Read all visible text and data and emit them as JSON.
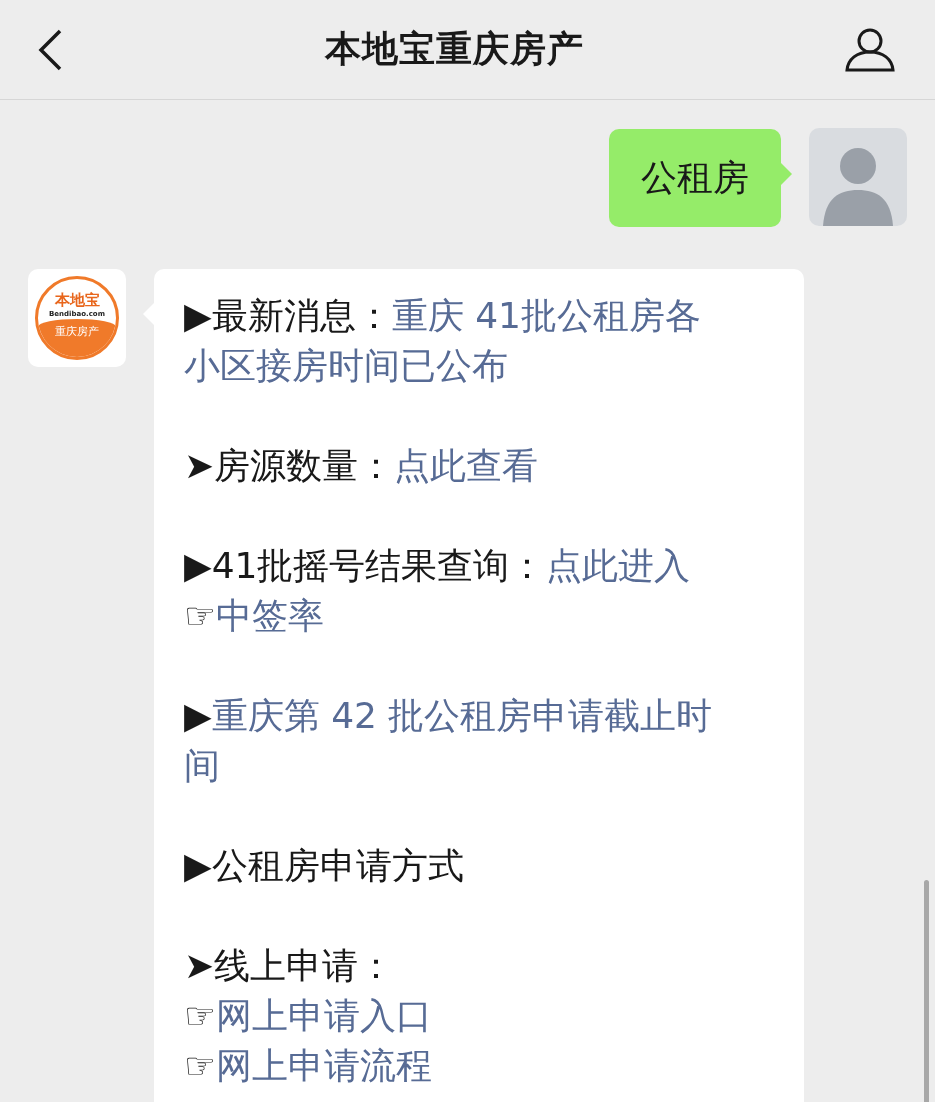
{
  "header": {
    "title": "本地宝重庆房产"
  },
  "messages": [
    {
      "kind": "sent",
      "text": "公租房"
    },
    {
      "kind": "received",
      "logo": {
        "name": "本地宝",
        "site": "Bendibao.com",
        "tagline": "重庆房产"
      },
      "paragraphs": [
        [
          {
            "marker": "▶",
            "segments": [
              {
                "kind": "text",
                "text": "最新消息："
              },
              {
                "kind": "link",
                "text": "重庆 41批公租房各"
              }
            ]
          },
          {
            "segments": [
              {
                "kind": "link",
                "text": "小区接房时间已公布"
              }
            ]
          }
        ],
        [
          {
            "marker": "➤",
            "segments": [
              {
                "kind": "text",
                "text": "房源数量："
              },
              {
                "kind": "link",
                "text": "点此查看"
              }
            ]
          }
        ],
        [
          {
            "marker": "▶",
            "segments": [
              {
                "kind": "text",
                "text": "41批摇号结果查询："
              },
              {
                "kind": "link",
                "text": "点此进入"
              }
            ]
          },
          {
            "marker": "☞",
            "segments": [
              {
                "kind": "link",
                "text": "中签率"
              }
            ]
          }
        ],
        [
          {
            "marker": "▶",
            "segments": [
              {
                "kind": "link",
                "text": "重庆第 42 批公租房申请截止时"
              }
            ]
          },
          {
            "segments": [
              {
                "kind": "link",
                "text": "间"
              }
            ]
          }
        ],
        [
          {
            "marker": "▶",
            "segments": [
              {
                "kind": "text",
                "text": "公租房申请方式"
              }
            ]
          }
        ],
        [
          {
            "marker": "➤",
            "segments": [
              {
                "kind": "text",
                "text": "线上申请："
              }
            ]
          },
          {
            "marker": "☞",
            "segments": [
              {
                "kind": "link",
                "text": "网上申请入口"
              }
            ]
          },
          {
            "marker": "☞",
            "segments": [
              {
                "kind": "link",
                "text": "网上申请流程"
              }
            ]
          }
        ]
      ]
    }
  ]
}
